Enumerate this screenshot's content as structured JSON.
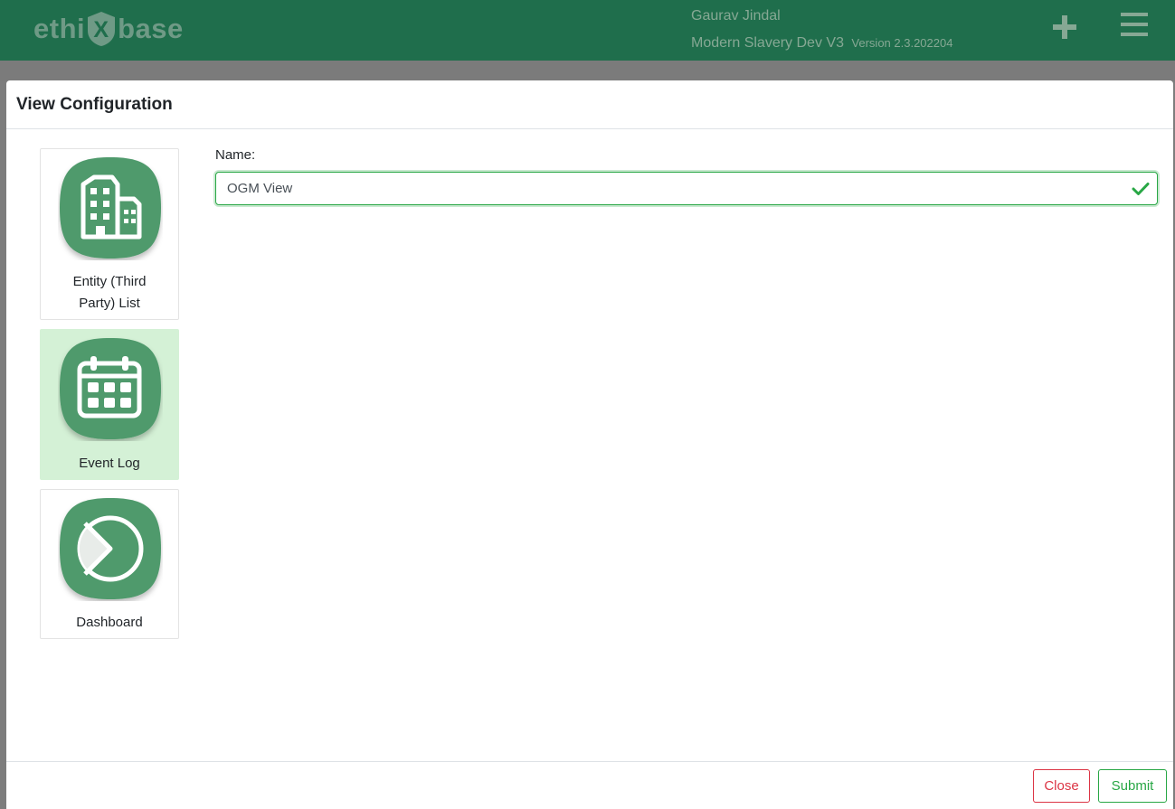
{
  "header": {
    "logo_left": "ethi",
    "logo_right": "base",
    "logo_mark": "X",
    "user_name": "Gaurav Jindal",
    "project_name": "Modern Slavery Dev V3",
    "version": "Version 2.3.202204",
    "add_icon": "plus-icon",
    "menu_icon": "hamburger-menu-icon"
  },
  "modal": {
    "title": "View Configuration",
    "tiles": [
      {
        "label_line1": "Entity (Third",
        "label_line2": "Party) List",
        "icon": "buildings-icon",
        "selected": false
      },
      {
        "label_line1": "Event Log",
        "icon": "calendar-icon",
        "selected": true
      },
      {
        "label_line1": "Dashboard",
        "icon": "pie-chart-icon",
        "selected": false
      }
    ],
    "name_label": "Name:",
    "name_value": "OGM View",
    "close_label": "Close",
    "submit_label": "Submit"
  },
  "colors": {
    "header_bg": "#1f6e4c",
    "tile_icon_green": "#4f9a6c",
    "selected_tile_bg": "#d4f1d6",
    "success": "#28a745",
    "danger": "#dc3545"
  }
}
